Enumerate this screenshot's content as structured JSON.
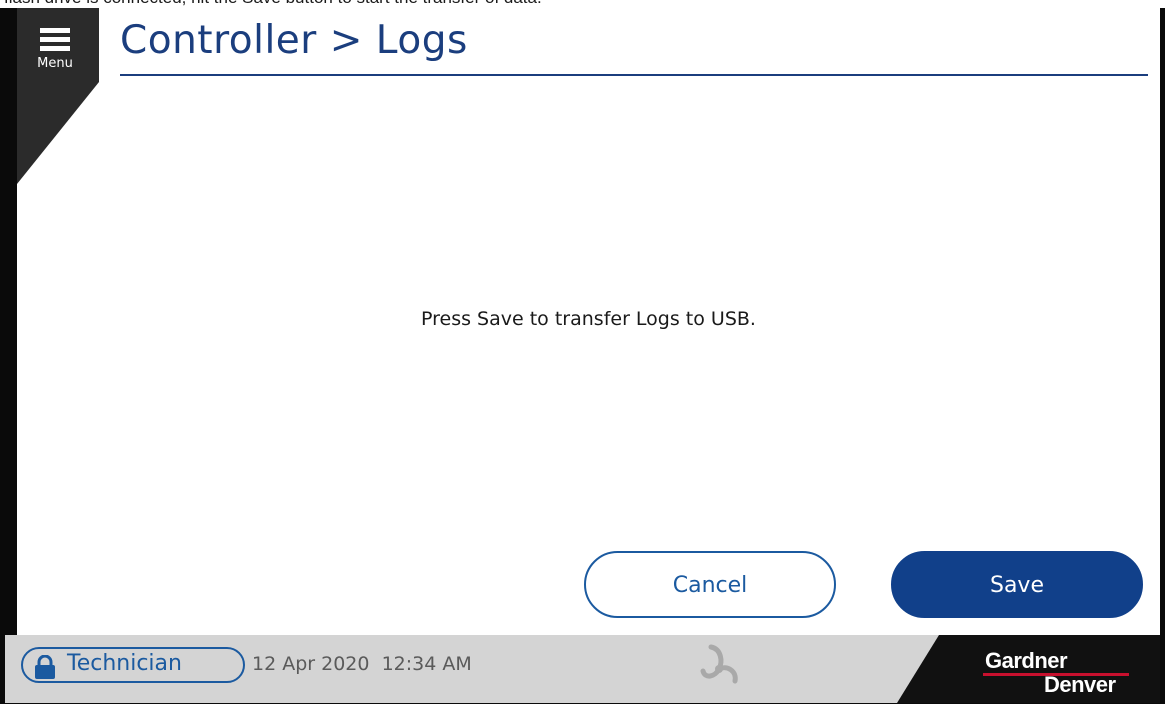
{
  "instruction_banner": "flash drive is connected, hit the Save button to start the transfer of data.",
  "menu": {
    "label": "Menu",
    "icon": "hamburger-icon"
  },
  "header": {
    "title": "Controller > Logs"
  },
  "main": {
    "message": "Press Save to transfer Logs to USB."
  },
  "buttons": {
    "cancel_label": "Cancel",
    "save_label": "Save"
  },
  "footer": {
    "user_level": "Technician",
    "lock_icon": "lock-icon",
    "date": "12 Apr 2020",
    "time": "12:34 AM",
    "status_icon": "connection-status-icon",
    "logo": {
      "line1": "Gardner",
      "line2": "Denver"
    }
  },
  "colors": {
    "primary": "#1b3e7e",
    "accent": "#1b5aa0",
    "button_fill": "#11408a",
    "footer_bg": "#d4d4d4",
    "logo_red": "#c8102e"
  }
}
